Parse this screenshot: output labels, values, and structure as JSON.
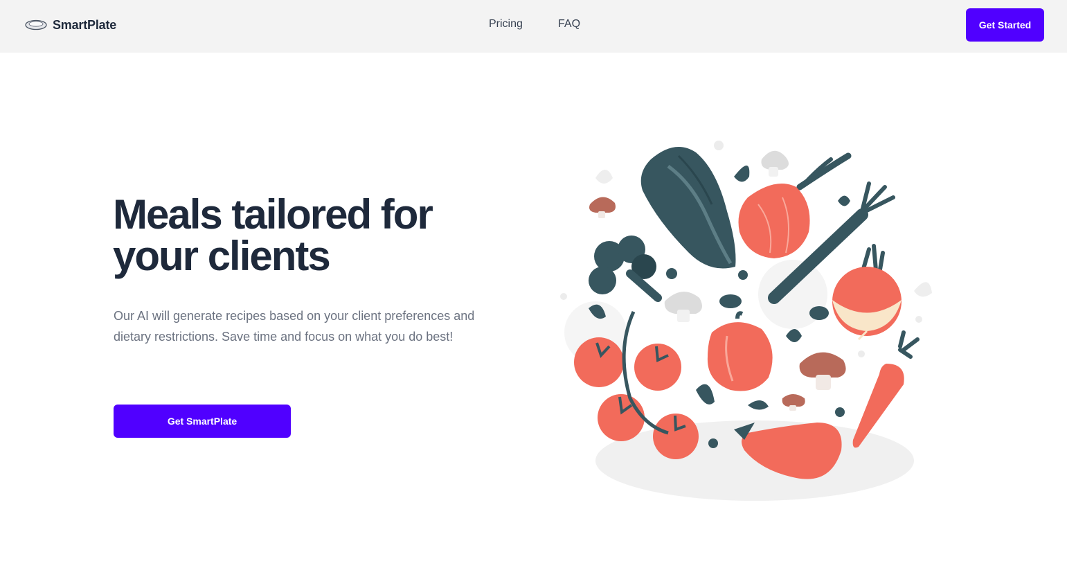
{
  "navbar": {
    "brand": {
      "name": "SmartPlate",
      "icon": "plate-icon"
    },
    "links": [
      {
        "label": "Pricing"
      },
      {
        "label": "FAQ"
      }
    ],
    "cta_label": "Get Started"
  },
  "hero": {
    "title_line1": "Meals tailored for",
    "title_line2": "your clients",
    "description": "Our AI will generate recipes based on your client preferences and dietary restrictions. Save time and focus on what you do best!",
    "cta_label": "Get SmartPlate"
  },
  "illustration": {
    "name": "vegetables-illustration"
  },
  "colors": {
    "accent": "#5000ff",
    "navbar_bg": "#f3f3f3",
    "heading": "#1e293b",
    "body_text": "#6b7280",
    "veg_red": "#f26b5b",
    "veg_dark": "#37565f"
  }
}
